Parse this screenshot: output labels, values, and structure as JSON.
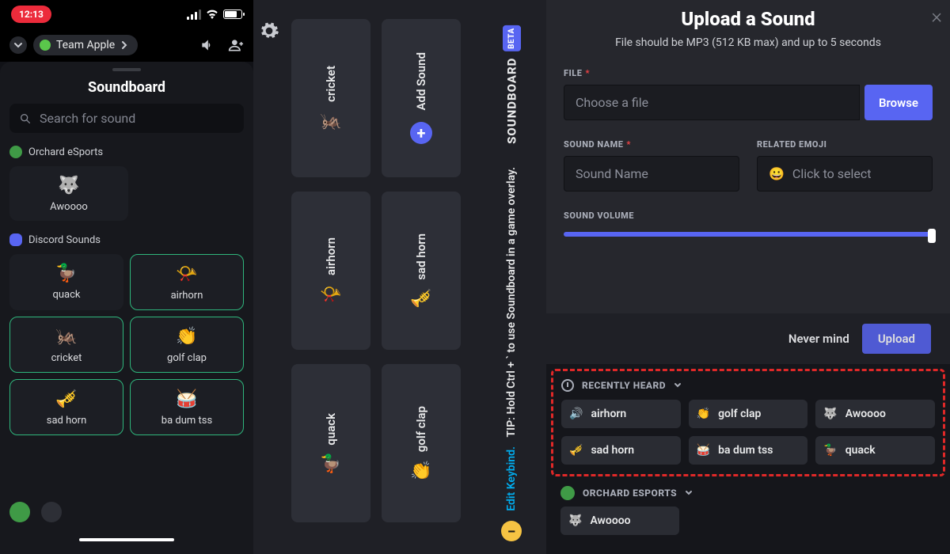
{
  "mobile": {
    "statusbar": {
      "time": "12:13"
    },
    "channel": {
      "name": "Team Apple"
    },
    "title": "Soundboard",
    "search": {
      "placeholder": "Search for sound"
    },
    "section_server": {
      "name": "Orchard eSports"
    },
    "server_sounds": [
      {
        "label": "Awoooo",
        "emoji": "🐺"
      }
    ],
    "section_discord": {
      "name": "Discord Sounds"
    },
    "discord_sounds": [
      {
        "label": "quack",
        "emoji": "🦆"
      },
      {
        "label": "airhorn",
        "emoji": "📯"
      },
      {
        "label": "cricket",
        "emoji": "🦗"
      },
      {
        "label": "golf clap",
        "emoji": "👏"
      },
      {
        "label": "sad horn",
        "emoji": "🎺"
      },
      {
        "label": "ba dum tss",
        "emoji": "🥁"
      }
    ]
  },
  "overlay": {
    "title": "SOUNDBOARD",
    "beta_badge": "BETA",
    "tip": "TIP: Hold Ctrl + ` to use Soundboard in a game overlay.",
    "edit_keybind": "Edit Keybind.",
    "cards": [
      {
        "label": "cricket",
        "emoji": "🦗"
      },
      {
        "label": "Add Sound",
        "is_add": true
      },
      {
        "label": "airhorn",
        "emoji": "📯"
      },
      {
        "label": "sad horn",
        "emoji": "🎺"
      },
      {
        "label": "quack",
        "emoji": "🦆"
      },
      {
        "label": "golf clap",
        "emoji": "👏"
      }
    ]
  },
  "upload": {
    "title": "Upload a Sound",
    "subtitle": "File should be MP3 (512 KB max) and up to 5 seconds",
    "file_label": "FILE",
    "file_placeholder": "Choose a file",
    "browse": "Browse",
    "name_label": "SOUND NAME",
    "name_placeholder": "Sound Name",
    "emoji_label": "RELATED EMOJI",
    "emoji_placeholder": "Click to select",
    "volume_label": "SOUND VOLUME",
    "never_mind": "Never mind",
    "upload": "Upload"
  },
  "recent": {
    "header": "RECENTLY HEARD",
    "items": [
      {
        "label": "airhorn",
        "emoji": "🔊"
      },
      {
        "label": "golf clap",
        "emoji": "👏"
      },
      {
        "label": "Awoooo",
        "emoji": "🐺"
      },
      {
        "label": "sad horn",
        "emoji": "🎺"
      },
      {
        "label": "ba dum tss",
        "emoji": "🥁"
      },
      {
        "label": "quack",
        "emoji": "🦆"
      }
    ],
    "server_header": "ORCHARD ESPORTS",
    "server_items": [
      {
        "label": "Awoooo",
        "emoji": "🐺"
      }
    ]
  }
}
